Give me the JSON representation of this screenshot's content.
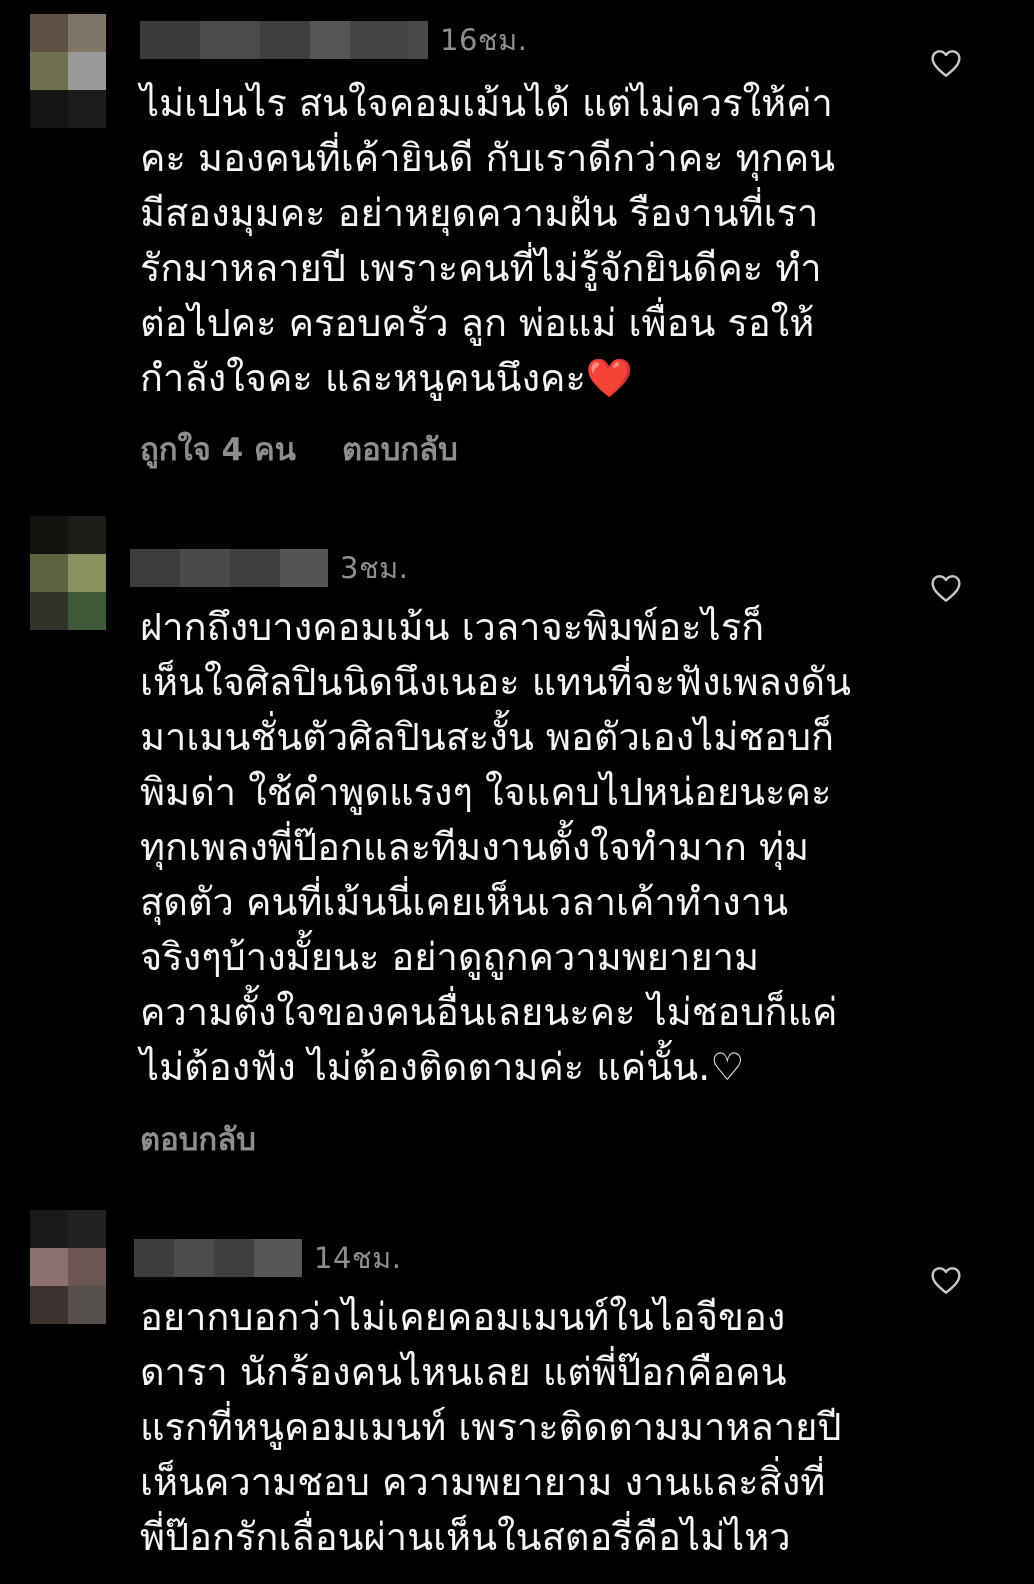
{
  "comments": [
    {
      "time": "16ชม.",
      "lines": [
        "ไม่เปนไร สนใจคอมเม้นได้ แต่ไม่ควรให้ค่า",
        "คะ มองคนที่เค้ายินดี กับเราดีกว่าคะ ทุกคน",
        "มีสองมุมคะ อย่าหยุดความฝัน รืองานที่เรา",
        "รักมาหลายปี เพราะคนที่ไม่รู้จักยินดีคะ ทำ",
        "ต่อไปคะ ครอบครัว ลูก พ่อแม่ เพื่อน รอให้",
        "กำลังใจคะ และหนูคนนึงคะ"
      ],
      "emoji": "❤️",
      "likes": "ถูกใจ 4 คน",
      "reply": "ตอบกลับ"
    },
    {
      "time": "3ชม.",
      "lines": [
        "ฝากถึงบางคอมเม้น เวลาจะพิมพ์อะไรก็",
        "เห็นใจศิลปินนิดนึงเนอะ แทนที่จะฟังเพลงดัน",
        "มาเมนชั่นตัวศิลปินสะงั้น พอตัวเองไม่ชอบก็",
        "พิมด่า ใช้คำพูดแรงๆ ใจแคบไปหน่อยนะคะ",
        "ทุกเพลงพี่ป๊อกและทีมงานตั้งใจทำมาก ทุ่ม",
        "สุดตัว คนที่เม้นนี่เคยเห็นเวลาเค้าทำงาน",
        "จริงๆบ้างมั้ยนะ อย่าดูถูกความพยายาม",
        "ความตั้งใจของคนอื่นเลยนะคะ ไม่ชอบก็แค่",
        "ไม่ต้องฟัง ไม่ต้องติดตามค่ะ แค่นั้น.♡"
      ],
      "reply": "ตอบกลับ"
    },
    {
      "time": "14ชม.",
      "lines": [
        "อยากบอกว่าไม่เคยคอมเมนท์ในไอจีของ",
        "ดารา นักร้องคนไหนเลย แต่พี่ป๊อกคือคน",
        "แรกที่หนูคอมเมนท์ เพราะติดตามมาหลายปี",
        "เห็นความชอบ ความพยายาม งานและสิ่งที่",
        "พี่ป๊อกรักเลื่อนผ่านเห็นในสตอรี่คือไม่ไหว"
      ]
    }
  ],
  "icons": {
    "like": "heart-outline-icon",
    "emoji": "red-heart-emoji"
  },
  "colors": {
    "background": "#000000",
    "text": "#f5f5f5",
    "secondary": "#8e8e8e",
    "emoji_red": "#e0262e"
  }
}
